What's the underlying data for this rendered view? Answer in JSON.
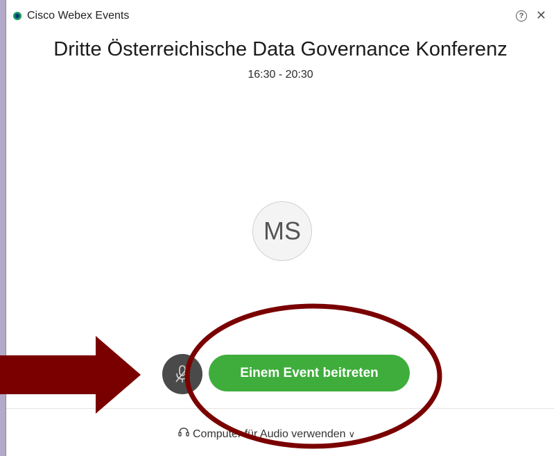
{
  "window": {
    "app_title": "Cisco Webex Events",
    "help_glyph": "?",
    "close_glyph": "✕"
  },
  "event": {
    "title": "Dritte Österreichische Data Governance Konferenz",
    "time": "16:30 - 20:30"
  },
  "avatar": {
    "initials": "MS"
  },
  "actions": {
    "join_label": "Einem Event beitreten",
    "audio_label": "Computer für Audio verwenden",
    "audio_chevron": "∨"
  },
  "annotations": {
    "arrow_color": "#7a0000",
    "ellipse_color": "#7a0000"
  },
  "icons": [
    "app-logo-icon",
    "help-icon",
    "close-icon",
    "microphone-icon",
    "headset-icon",
    "chevron-down-icon"
  ]
}
